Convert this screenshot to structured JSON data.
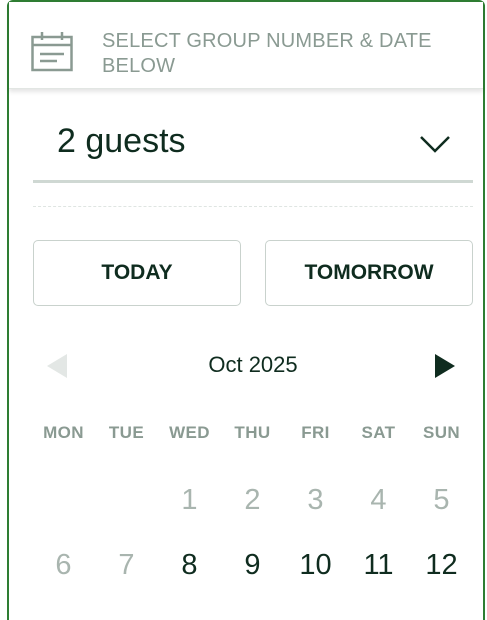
{
  "header": {
    "icon": "calendar-icon",
    "instruction": "SELECT GROUP NUMBER & DATE BELOW"
  },
  "guests": {
    "selected": "2 guests",
    "icon": "chevron-down-icon"
  },
  "quick_dates": {
    "today_label": "TODAY",
    "tomorrow_label": "TOMORROW"
  },
  "calendar": {
    "month_label": "Oct 2025",
    "prev_icon": "triangle-left-icon",
    "next_icon": "triangle-right-icon",
    "weekdays": [
      "MON",
      "TUE",
      "WED",
      "THU",
      "FRI",
      "SAT",
      "SUN"
    ],
    "week1": [
      "",
      "",
      "1",
      "2",
      "3",
      "4",
      "5"
    ],
    "week2": [
      "6",
      "7",
      "8",
      "9",
      "10",
      "11",
      "12"
    ]
  },
  "colors": {
    "border_accent": "#2e7d32",
    "text_dark": "#0f2c1f",
    "text_muted": "#8a9a92",
    "day_disabled": "#a9b5af"
  }
}
